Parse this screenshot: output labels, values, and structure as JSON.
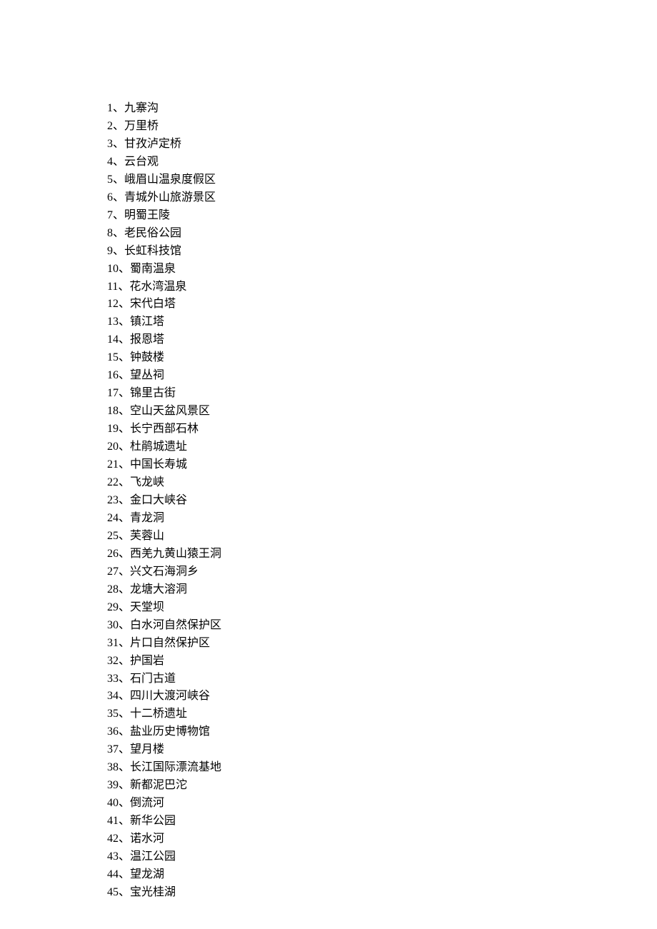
{
  "separator": "、",
  "items": [
    {
      "n": "1",
      "text": "九寨沟"
    },
    {
      "n": "2",
      "text": "万里桥"
    },
    {
      "n": "3",
      "text": "甘孜泸定桥"
    },
    {
      "n": "4",
      "text": "云台观"
    },
    {
      "n": "5",
      "text": "峨眉山温泉度假区"
    },
    {
      "n": "6",
      "text": "青城外山旅游景区"
    },
    {
      "n": "7",
      "text": "明蜀王陵"
    },
    {
      "n": "8",
      "text": "老民俗公园"
    },
    {
      "n": "9",
      "text": "长虹科技馆"
    },
    {
      "n": "10",
      "text": "蜀南温泉"
    },
    {
      "n": "11",
      "text": "花水湾温泉"
    },
    {
      "n": "12",
      "text": "宋代白塔"
    },
    {
      "n": "13",
      "text": "镇江塔"
    },
    {
      "n": "14",
      "text": "报恩塔"
    },
    {
      "n": "15",
      "text": "钟鼓楼"
    },
    {
      "n": "16",
      "text": "望丛祠"
    },
    {
      "n": "17",
      "text": "锦里古街"
    },
    {
      "n": "18",
      "text": "空山天盆风景区"
    },
    {
      "n": "19",
      "text": "长宁西部石林"
    },
    {
      "n": "20",
      "text": "杜鹃城遗址"
    },
    {
      "n": "21",
      "text": "中国长寿城"
    },
    {
      "n": "22",
      "text": "飞龙峡"
    },
    {
      "n": "23",
      "text": "金口大峡谷"
    },
    {
      "n": "24",
      "text": "青龙洞"
    },
    {
      "n": "25",
      "text": "芙蓉山"
    },
    {
      "n": "26",
      "text": "西羌九黄山猿王洞"
    },
    {
      "n": "27",
      "text": "兴文石海洞乡"
    },
    {
      "n": "28",
      "text": "龙塘大溶洞"
    },
    {
      "n": "29",
      "text": "天堂坝"
    },
    {
      "n": "30",
      "text": "白水河自然保护区"
    },
    {
      "n": "31",
      "text": "片口自然保护区"
    },
    {
      "n": "32",
      "text": "护国岩"
    },
    {
      "n": "33",
      "text": "石门古道"
    },
    {
      "n": "34",
      "text": "四川大渡河峡谷"
    },
    {
      "n": "35",
      "text": "十二桥遗址"
    },
    {
      "n": "36",
      "text": "盐业历史博物馆"
    },
    {
      "n": "37",
      "text": "望月楼"
    },
    {
      "n": "38",
      "text": "长江国际漂流基地"
    },
    {
      "n": "39",
      "text": "新都泥巴沱"
    },
    {
      "n": "40",
      "text": "倒流河"
    },
    {
      "n": "41",
      "text": "新华公园"
    },
    {
      "n": "42",
      "text": "诺水河"
    },
    {
      "n": "43",
      "text": "温江公园"
    },
    {
      "n": "44",
      "text": "望龙湖"
    },
    {
      "n": "45",
      "text": "宝光桂湖"
    }
  ]
}
